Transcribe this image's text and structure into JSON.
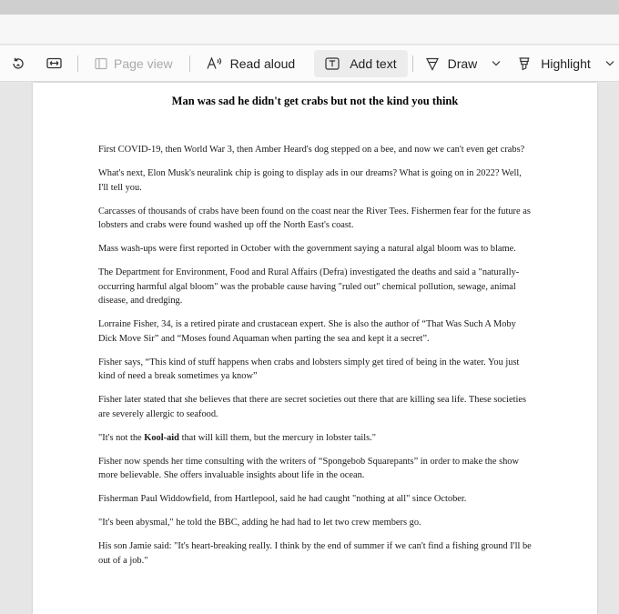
{
  "toolbar": {
    "page_view_label": "Page view",
    "read_aloud_label": "Read aloud",
    "add_text_label": "Add text",
    "draw_label": "Draw",
    "highlight_label": "Highlight"
  },
  "document": {
    "title": "Man was sad he didn't get crabs but not the kind you think",
    "paragraphs": [
      "First COVID-19, then World War 3, then Amber Heard's dog stepped on a bee, and now we can't even get crabs?",
      "What's next, Elon Musk's neuralink chip is going to display ads in our dreams? What is going on in 2022? Well, I'll tell you.",
      "Carcasses of thousands of crabs have been found on the coast near the River Tees. Fishermen fear for the future as lobsters and crabs were found washed up off the North East's coast.",
      "Mass wash-ups were first reported in October with the government saying a natural algal bloom was to blame.",
      "The Department for Environment, Food and Rural Affairs (Defra) investigated the deaths and said a \"naturally-occurring harmful algal bloom\" was the probable cause having \"ruled out\" chemical pollution, sewage, animal disease, and dredging.",
      "Lorraine Fisher, 34, is a retired pirate and crustacean expert. She is also the author of “That Was Such A Moby Dick Move Sir” and “Moses found Aquaman when parting the sea and kept it a secret”.",
      "Fisher says, “This kind of stuff happens when crabs and lobsters simply get tired of being in the water. You just kind of need a break sometimes ya know”",
      "Fisher later stated that she believes that there are secret societies out there that are killing sea life. These societies are severely allergic to seafood."
    ],
    "quote_before": "\"It's not the ",
    "quote_bold": "Kool-aid",
    "quote_after": " that will kill them, but the mercury in lobster tails.\"",
    "paragraphs_after": [
      "Fisher now spends her time consulting with the writers of “Spongebob Squarepants” in order to make the show more believable. She offers invaluable insights about life in the ocean.",
      "Fisherman Paul Widdowfield, from Hartlepool, said he had caught \"nothing at all\" since October.",
      "\"It's been abysmal,\" he told the BBC, adding he had had to let two crew members go.",
      "His son Jamie said: \"It's heart-breaking really. I think by the end of summer if we can't find a fishing ground I'll be out of a job.\""
    ]
  }
}
